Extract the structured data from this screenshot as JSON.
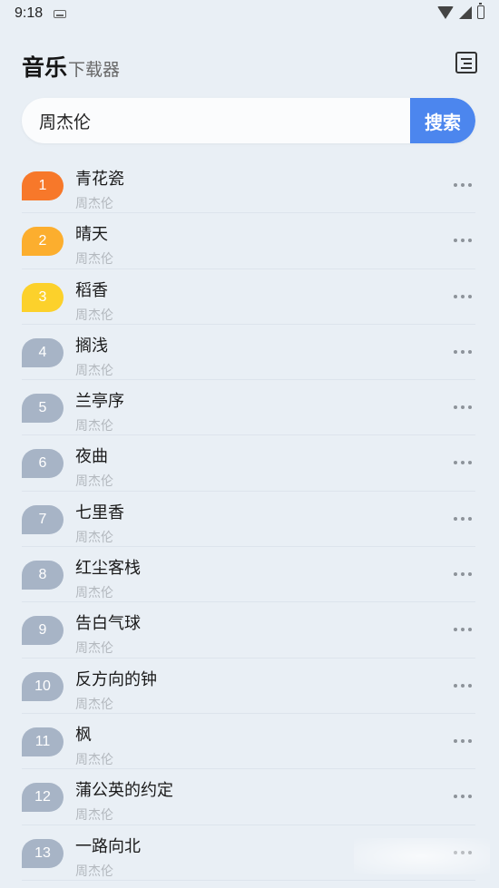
{
  "status_bar": {
    "time": "9:18"
  },
  "header": {
    "title_main": "音乐",
    "title_sub": "下载器"
  },
  "search": {
    "value": "周杰伦",
    "button_label": "搜索"
  },
  "colors": {
    "accent": "#4c86ee",
    "rank_1": "#f7782a",
    "rank_2": "#fcae2e",
    "rank_3": "#fcd12b",
    "rank_other": "#a7b4c6"
  },
  "songs": [
    {
      "rank": "1",
      "title": "青花瓷",
      "artist": "周杰伦"
    },
    {
      "rank": "2",
      "title": "晴天",
      "artist": "周杰伦"
    },
    {
      "rank": "3",
      "title": "稻香",
      "artist": "周杰伦"
    },
    {
      "rank": "4",
      "title": "搁浅",
      "artist": "周杰伦"
    },
    {
      "rank": "5",
      "title": "兰亭序",
      "artist": "周杰伦"
    },
    {
      "rank": "6",
      "title": "夜曲",
      "artist": "周杰伦"
    },
    {
      "rank": "7",
      "title": "七里香",
      "artist": "周杰伦"
    },
    {
      "rank": "8",
      "title": "红尘客栈",
      "artist": "周杰伦"
    },
    {
      "rank": "9",
      "title": "告白气球",
      "artist": "周杰伦"
    },
    {
      "rank": "10",
      "title": "反方向的钟",
      "artist": "周杰伦"
    },
    {
      "rank": "11",
      "title": "枫",
      "artist": "周杰伦"
    },
    {
      "rank": "12",
      "title": "蒲公英的约定",
      "artist": "周杰伦"
    },
    {
      "rank": "13",
      "title": "一路向北",
      "artist": "周杰伦"
    }
  ]
}
